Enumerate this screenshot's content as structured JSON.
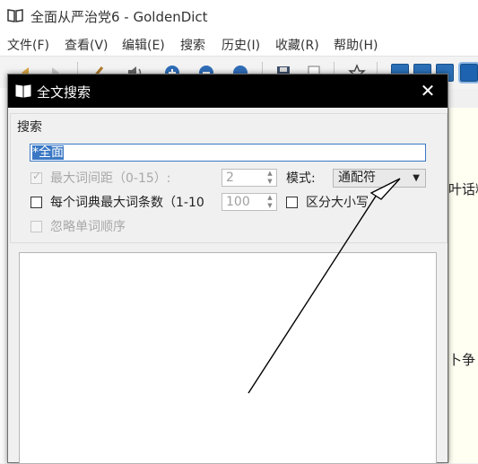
{
  "window": {
    "title": "全面从严治党6 - GoldenDict"
  },
  "menu": [
    "文件(F)",
    "查看(V)",
    "编辑(E)",
    "搜索",
    "历史(I)",
    "收藏(R)",
    "帮助(H)"
  ],
  "background_fragments": {
    "line1": "叶话料",
    "line2": "卜争"
  },
  "dialog": {
    "title": "全文搜索",
    "close_glyph": "✕",
    "group_title": "搜索",
    "query_value": "*全面",
    "max_distance": {
      "label": "最大词间距（0-15）:",
      "value": "2",
      "checked": true,
      "enabled": false
    },
    "mode": {
      "label": "模式:",
      "value": "通配符"
    },
    "max_articles": {
      "label": "每个词典最大词条数（1-10",
      "value": "100",
      "checked": false
    },
    "match_case": {
      "label": "区分大小写",
      "checked": false
    },
    "ignore_order": {
      "label": "忽略单词顺序",
      "checked": false,
      "enabled": false
    }
  },
  "colors": {
    "dialog_titlebar": "#000000",
    "selection": "#3a78c4",
    "annotation_arrow": "#000000"
  }
}
